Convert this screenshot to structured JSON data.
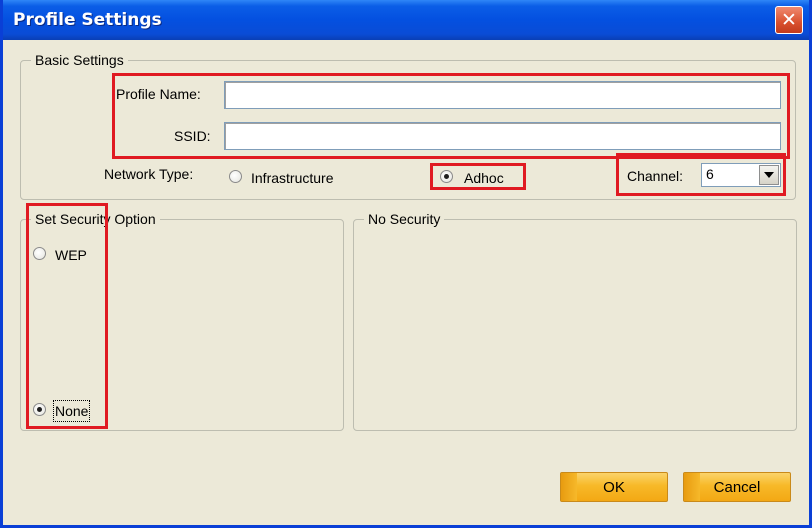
{
  "window": {
    "title": "Profile Settings",
    "close_glyph": "✕"
  },
  "basic_settings": {
    "legend": "Basic Settings",
    "profile_name_label": "Profile Name:",
    "profile_name_value": "",
    "ssid_label": "SSID:",
    "ssid_value": "",
    "network_type_label": "Network Type:",
    "network_types": [
      {
        "label": "Infrastructure",
        "checked": false
      },
      {
        "label": "Adhoc",
        "checked": true
      }
    ],
    "channel_label": "Channel:",
    "channel_value": "6"
  },
  "security": {
    "legend": "Set Security Option",
    "options": [
      {
        "label": "WEP",
        "checked": false
      },
      {
        "label": "None",
        "checked": true
      }
    ]
  },
  "details": {
    "legend": "No Security"
  },
  "buttons": {
    "ok": "OK",
    "cancel": "Cancel"
  },
  "colors": {
    "highlight": "#e01a22",
    "title_bar": "#0450e0",
    "button": "#f7b928"
  }
}
